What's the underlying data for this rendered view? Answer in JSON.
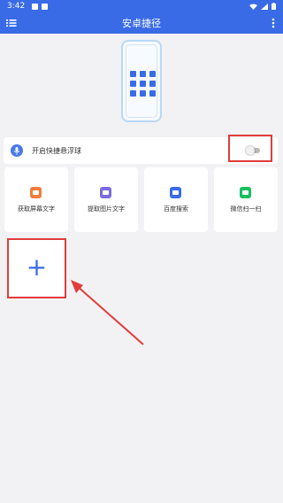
{
  "status_bar": {
    "time": "3:42",
    "left_icons": [
      "image-icon",
      "notification-icon"
    ],
    "right_icons": [
      "wifi-icon",
      "signal-icon",
      "battery-icon"
    ]
  },
  "app_bar": {
    "title": "安卓捷径",
    "menu_icon": "menu-icon",
    "more_icon": "more-vertical-icon"
  },
  "floating_ball": {
    "label": "开启快捷悬浮球",
    "icon": "mic-icon",
    "toggle_on": false
  },
  "shortcuts": [
    {
      "label": "获取屏幕文字",
      "icon": "screen-text-icon",
      "color": "#f07d3c"
    },
    {
      "label": "提取图片文字",
      "icon": "image-text-icon",
      "color": "#7a6ce0"
    },
    {
      "label": "百度搜索",
      "icon": "baidu-icon",
      "color": "#3a6be6"
    },
    {
      "label": "微信扫一扫",
      "icon": "scan-icon",
      "color": "#11c05c"
    }
  ],
  "add_tile": {
    "symbol": "+"
  },
  "colors": {
    "primary": "#3a6be6",
    "annotation": "#e23b3b",
    "background": "#f2f2f4"
  }
}
